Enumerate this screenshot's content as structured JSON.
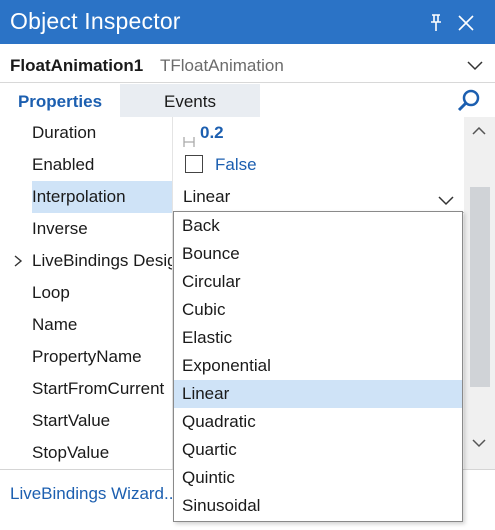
{
  "window": {
    "title": "Object Inspector"
  },
  "object_selector": {
    "name": "FloatAnimation1",
    "class_name": "TFloatAnimation"
  },
  "tabs": [
    {
      "label": "Properties",
      "active": true
    },
    {
      "label": "Events",
      "active": false
    }
  ],
  "properties": [
    {
      "name": "Duration",
      "value": "0.2"
    },
    {
      "name": "Enabled",
      "value": "False",
      "checked": false
    },
    {
      "name": "Interpolation",
      "value": "Linear",
      "selected": true
    },
    {
      "name": "Inverse",
      "value": ""
    },
    {
      "name": "LiveBindings Designer",
      "value": "",
      "expandable": true
    },
    {
      "name": "Loop",
      "value": ""
    },
    {
      "name": "Name",
      "value": ""
    },
    {
      "name": "PropertyName",
      "value": ""
    },
    {
      "name": "StartFromCurrent",
      "value": ""
    },
    {
      "name": "StartValue",
      "value": ""
    },
    {
      "name": "StopValue",
      "value": ""
    }
  ],
  "interpolation_dropdown": {
    "options": [
      "Back",
      "Bounce",
      "Circular",
      "Cubic",
      "Elastic",
      "Exponential",
      "Linear",
      "Quadratic",
      "Quartic",
      "Quintic",
      "Sinusoidal"
    ],
    "selected": "Linear"
  },
  "footer": {
    "link": "LiveBindings Wizard..."
  },
  "colors": {
    "titlebar": "#2b73c6",
    "accent_text": "#1c5fb0",
    "selection": "#cfe3f7"
  },
  "icons": [
    "pin-icon",
    "close-icon",
    "chevron-down-icon",
    "search-icon",
    "expand-arrow-icon",
    "scroll-up-icon",
    "scroll-down-icon"
  ]
}
